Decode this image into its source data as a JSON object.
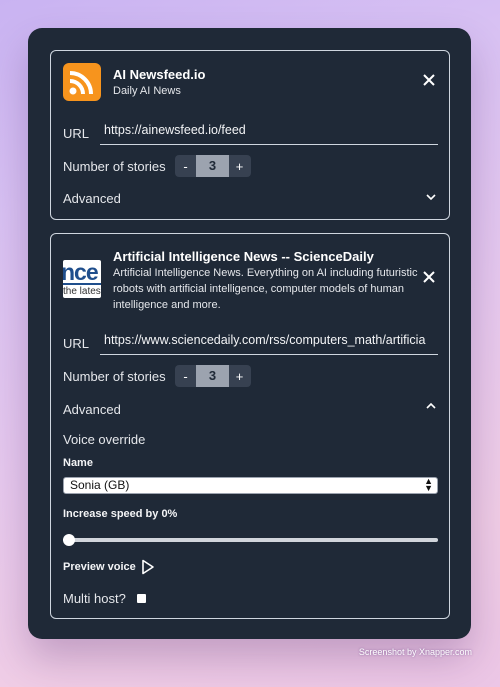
{
  "feeds": [
    {
      "title": "AI Newsfeed.io",
      "subtitle": "Daily AI News",
      "url_label": "URL",
      "url": "https://ainewsfeed.io/feed",
      "stories_label": "Number of stories",
      "stories": "3",
      "advanced_label": "Advanced"
    },
    {
      "title": "Artificial Intelligence News -- ScienceDaily",
      "description": "Artificial Intelligence News. Everything on AI including futuristic robots with artificial intelligence, computer models of human intelligence and more.",
      "thumb_big": "nce",
      "thumb_small": "the lates",
      "url_label": "URL",
      "url": "https://www.sciencedaily.com/rss/computers_math/artificia",
      "stories_label": "Number of stories",
      "stories": "3",
      "advanced_label": "Advanced",
      "voice_override_label": "Voice override",
      "name_label": "Name",
      "voice_name": "Sonia (GB)",
      "speed_label": "Increase speed by 0%",
      "speed_value": 0,
      "preview_label": "Preview voice",
      "multi_host_label": "Multi host?"
    }
  ],
  "stepper": {
    "minus": "-",
    "plus": "+"
  },
  "footer": "Screenshot by Xnapper.com",
  "colors": {
    "panel": "#1f2937",
    "rss": "#f7941d"
  }
}
